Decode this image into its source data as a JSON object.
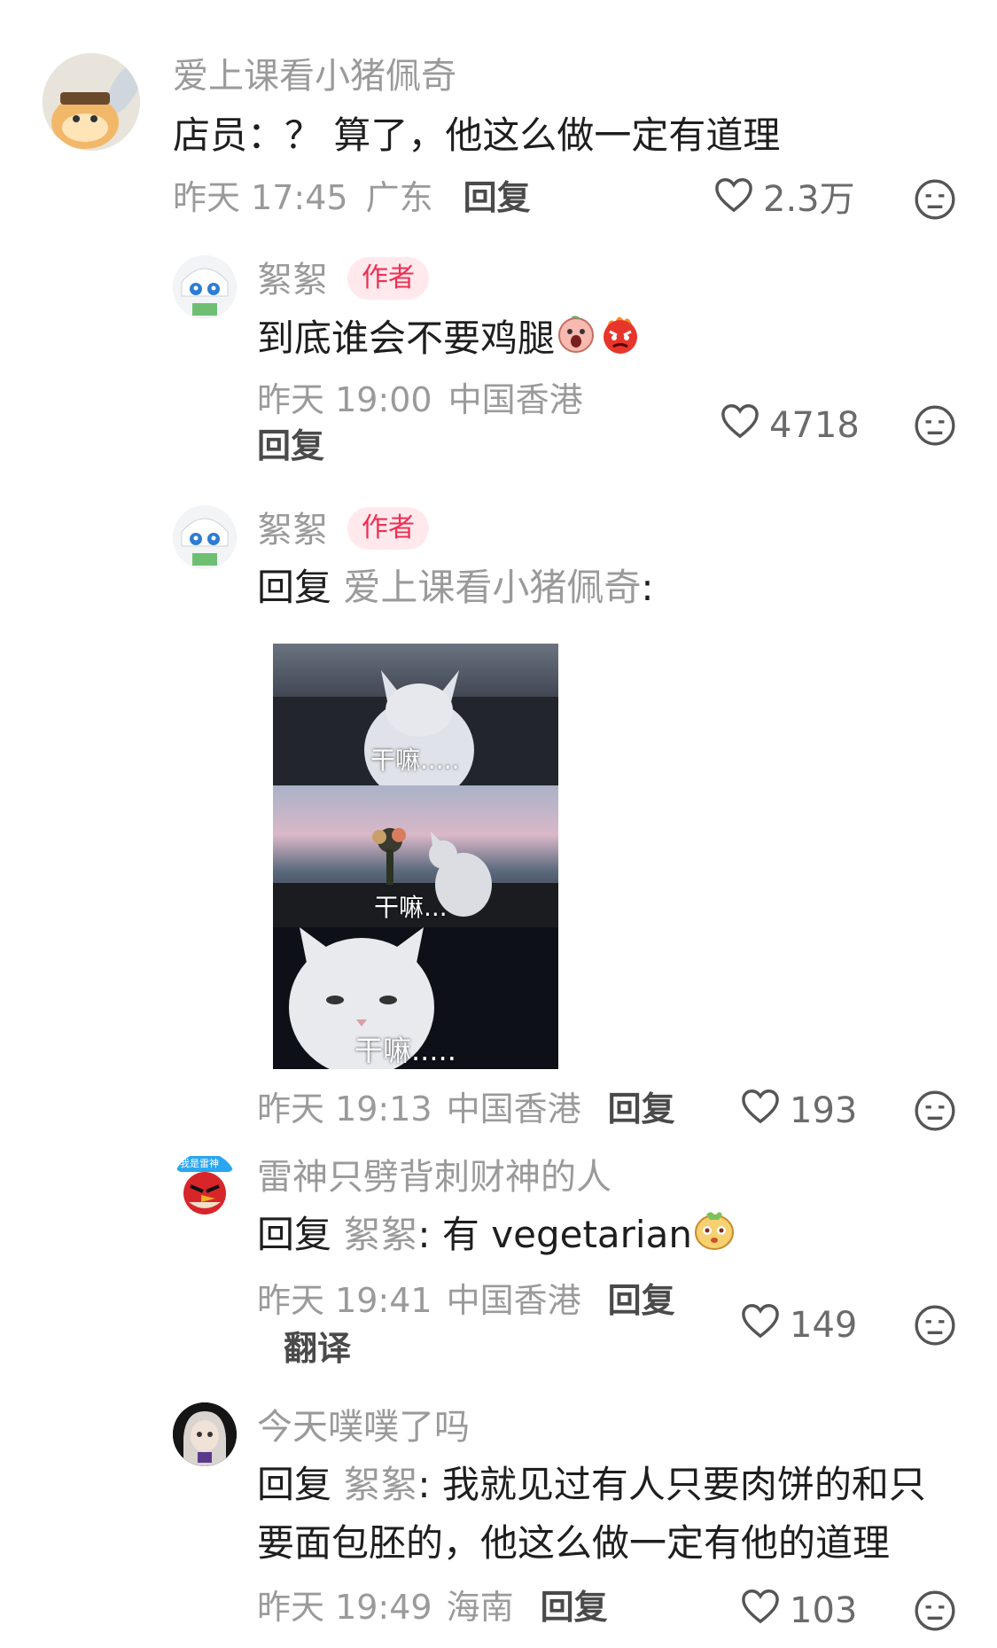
{
  "comments": [
    {
      "username": "爱上课看小猪佩奇",
      "text": "店员：？ 算了，他这么做一定有道理",
      "time": "昨天 17:45",
      "location": "广东",
      "reply_label": "回复",
      "likes": "2.3万"
    },
    {
      "username": "絮絮",
      "badge": "作者",
      "text": "到底谁会不要鸡腿",
      "time": "昨天 19:00",
      "location": "中国香港",
      "reply_label": "回复",
      "likes": "4718"
    },
    {
      "username": "絮絮",
      "badge": "作者",
      "reply_prefix": "回复",
      "reply_to": "爱上课看小猪佩奇",
      "colon": ":",
      "meme_captions": [
        "干嘛.....",
        "干嘛...",
        "干嘛....."
      ],
      "time": "昨天 19:13",
      "location": "中国香港",
      "reply_label": "回复",
      "likes": "193"
    },
    {
      "username": "雷神只劈背刺财神的人",
      "avatar_text": "我是雷神",
      "reply_prefix": "回复",
      "reply_to": "絮絮",
      "colon": ":",
      "text": "有 vegetarian",
      "time": "昨天 19:41",
      "location": "中国香港",
      "reply_label": "回复",
      "translate_label": "翻译",
      "likes": "149"
    },
    {
      "username": "今天噗噗了吗",
      "reply_prefix": "回复",
      "reply_to": "絮絮",
      "colon": ":",
      "text_line1": "我就见过有人只要肉饼的和只",
      "text_line2": "要面包胚的，他这么做一定有他的道理",
      "time": "昨天 19:49",
      "location": "海南",
      "reply_label": "回复",
      "likes": "103"
    }
  ],
  "colors": {
    "badge_bg": "#ffe9ec",
    "badge_text": "#ee2f54",
    "meta": "#9a9a9a",
    "text": "#1e1e1e"
  },
  "icons": [
    "heart-outline-icon",
    "meh-face-icon",
    "emoji-screaming",
    "emoji-angry-flame",
    "emoji-cute-face"
  ]
}
